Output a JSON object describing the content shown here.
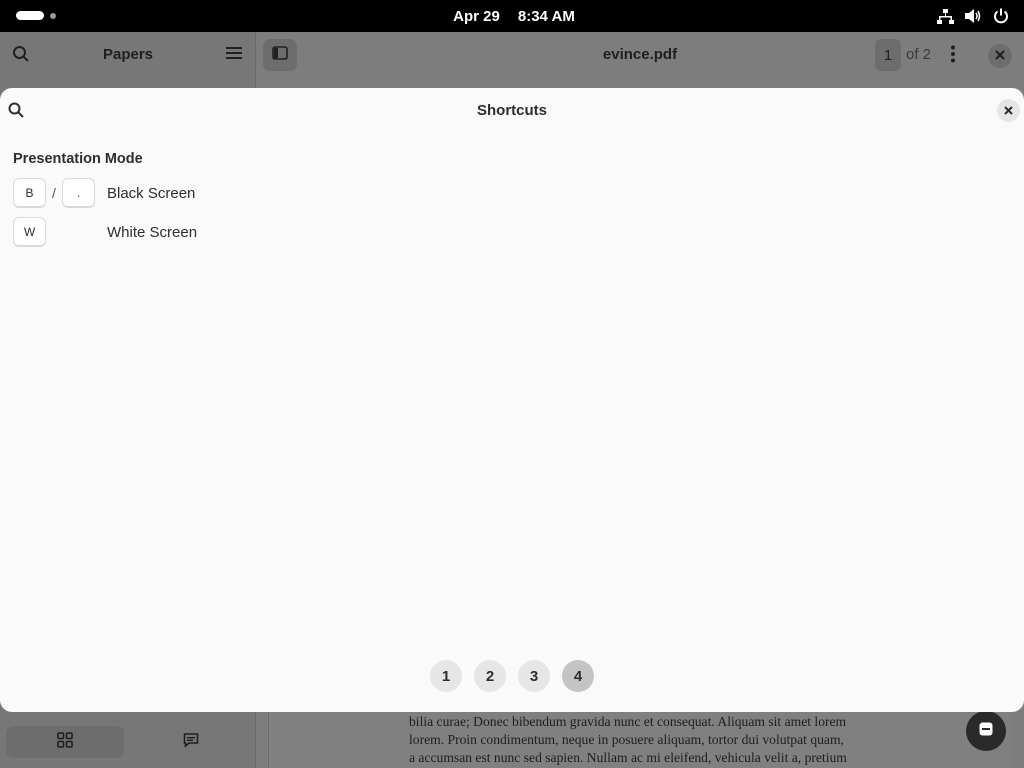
{
  "topbar": {
    "date": "Apr 29",
    "time": "8:34 AM",
    "icons": [
      "network-icon",
      "volume-icon",
      "power-icon"
    ]
  },
  "sidebar": {
    "title": "Papers",
    "tabs": [
      "thumbnails-icon",
      "annotations-icon"
    ]
  },
  "viewer": {
    "title": "evince.pdf",
    "current_page": "1",
    "page_of": "of 2",
    "page_text": [
      "bilia curae; Donec bibendum gravida nunc et consequat. Aliquam sit amet lorem",
      "lorem. Proin condimentum, neque in posuere aliquam, tortor dui volutpat quam,",
      "a accumsan est nunc sed sapien. Nullam ac mi eleifend, vehicula velit a, pretium"
    ]
  },
  "dialog": {
    "title": "Shortcuts",
    "section": "Presentation Mode",
    "shortcuts": [
      {
        "keys": [
          "B",
          "."
        ],
        "separator": "/",
        "description": "Black Screen"
      },
      {
        "keys": [
          "W"
        ],
        "description": "White Screen"
      }
    ],
    "pages": [
      "1",
      "2",
      "3",
      "4"
    ],
    "active_page": "4"
  }
}
